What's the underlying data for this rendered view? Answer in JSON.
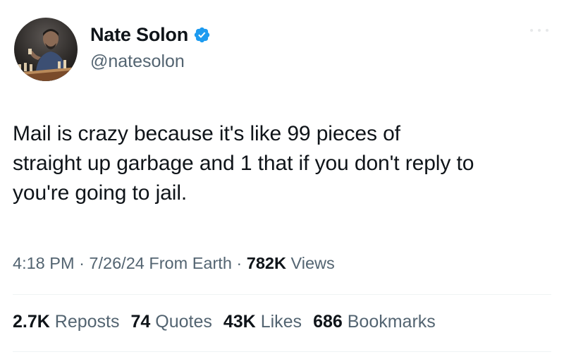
{
  "colors": {
    "text_primary": "#0f1419",
    "text_secondary": "#536471",
    "verified_badge": "#1d9bf0",
    "divider": "#eff3f4"
  },
  "author": {
    "display_name": "Nate Solon",
    "handle": "@natesolon",
    "verified": true,
    "avatar_icon": "profile-photo-chessboard"
  },
  "tweet": {
    "text": "Mail is crazy because it's like 99 pieces of\nstraight up garbage and 1 that if you don't reply to\nyou're going to jail."
  },
  "meta": {
    "time": "4:18 PM",
    "separator": "·",
    "date": "7/26/24",
    "source": "From Earth",
    "views_count": "782K",
    "views_label": "Views"
  },
  "stats": [
    {
      "count": "2.7K",
      "label": "Reposts"
    },
    {
      "count": "74",
      "label": "Quotes"
    },
    {
      "count": "43K",
      "label": "Likes"
    },
    {
      "count": "686",
      "label": "Bookmarks"
    }
  ]
}
